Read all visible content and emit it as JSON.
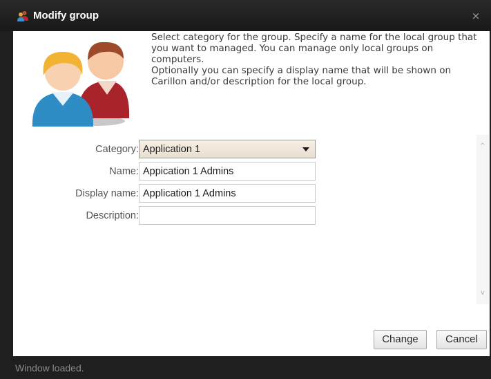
{
  "window": {
    "title": "Modify group",
    "close_glyph": "×",
    "title_icon": "users-icon"
  },
  "info": {
    "line1": "Select category for the group. Specify a name for the local group that you want to managed. You can manage only local groups on computers.",
    "line2": "Optionally you can specify a display name that will be shown on Carillon and/or description for the local group."
  },
  "illustration": "group-users-icon",
  "form": {
    "category": {
      "label": "Category:",
      "value": "Application 1"
    },
    "name": {
      "label": "Name:",
      "value": "Appication 1 Admins"
    },
    "display_name": {
      "label": "Display name:",
      "value": "Application 1 Admins"
    },
    "description": {
      "label": "Description:",
      "value": ""
    }
  },
  "scrollbar": {
    "up_glyph": "^",
    "down_glyph": "v"
  },
  "buttons": {
    "change": "Change",
    "cancel": "Cancel"
  },
  "status": {
    "text": "Window loaded."
  },
  "colors": {
    "titlebar": "#1f1f1f",
    "client": "#ffffff",
    "select_bg": "#f0e8dc"
  }
}
